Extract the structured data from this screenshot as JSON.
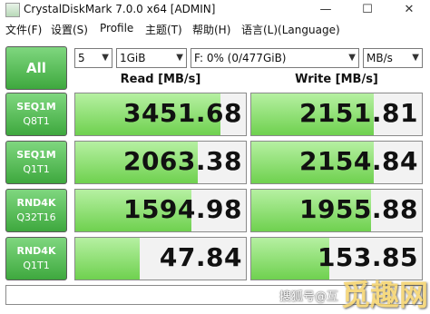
{
  "window": {
    "title": "CrystalDiskMark 7.0.0 x64 [ADMIN]",
    "minimize": "—",
    "maximize": "☐",
    "close": "✕"
  },
  "menu": [
    "文件(F)",
    "设置(S)",
    "Profile",
    "主题(T)",
    "帮助(H)",
    "语言(L)(Language)"
  ],
  "controls": {
    "all_label": "All",
    "count": "5",
    "size": "1GiB",
    "drive": "F: 0% (0/477GiB)",
    "unit": "MB/s"
  },
  "headers": {
    "read": "Read [MB/s]",
    "write": "Write [MB/s]"
  },
  "rows": [
    {
      "line1": "SEQ1M",
      "line2": "Q8T1",
      "read": "3451.68",
      "write": "2151.81",
      "read_fill": 0.85,
      "write_fill": 0.72
    },
    {
      "line1": "SEQ1M",
      "line2": "Q1T1",
      "read": "2063.38",
      "write": "2154.84",
      "read_fill": 0.72,
      "write_fill": 0.72
    },
    {
      "line1": "RND4K",
      "line2": "Q32T16",
      "read": "1594.98",
      "write": "1955.88",
      "read_fill": 0.68,
      "write_fill": 0.7
    },
    {
      "line1": "RND4K",
      "line2": "Q1T1",
      "read": "47.84",
      "write": "153.85",
      "read_fill": 0.38,
      "write_fill": 0.46
    }
  ],
  "status_text": "",
  "watermark": "搜狐号@互",
  "logo_text": "觅趣网"
}
